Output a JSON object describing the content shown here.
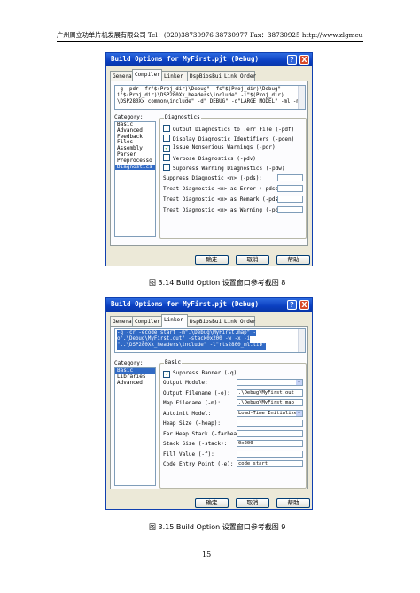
{
  "page_header": {
    "text": "广州周立功单片机发展有限公司    Tel：(020)38730976    38730977    Fax：38730925    http://www.zlgmcu.com"
  },
  "dialog1": {
    "title": "Build Options for MyFirst.pjt (Debug)",
    "help_btn": "?",
    "close_btn": "X",
    "tabs": [
      "General",
      "Compiler",
      "Linker",
      "DspBiosBuilder",
      "Link Order"
    ],
    "active_tab": 1,
    "options_lines": [
      "-g -pdr -fr\"$(Proj_dir)\\Debug\" -fs\"$(Proj_dir)\\Debug\" -",
      "i\"$(Proj_dir)\\DSP280Xx_headers\\include\" -i\"$(Proj_dir)",
      "\\DSP280Xx_common\\include\" -d\"_DEBUG\" -d\"LARGE_MODEL\" -ml -mt"
    ],
    "category_label": "Category:",
    "categories": [
      "Basic",
      "Advanced",
      "Feedback",
      "Files",
      "Assembly",
      "Parser",
      "Preprocesso",
      "Diagnostics"
    ],
    "selected_category": 7,
    "group_title": "Diagnostics",
    "checkboxes": [
      {
        "label": "Output Diagnostics to .err File (-pdf)",
        "checked": false
      },
      {
        "label": "Display Diagnostic Identifiers (-pden)",
        "checked": false
      },
      {
        "label": "Issue Nonserious Warnings (-pdr)",
        "checked": true
      },
      {
        "label": "Verbose Diagnostics (-pdv)",
        "checked": false
      },
      {
        "label": "Suppress Warning Diagnostics (-pdw)",
        "checked": false
      }
    ],
    "fields": [
      "Suppress Diagnostic <n> (-pds):",
      "Treat Diagnostic <n> as Error (-pdse):",
      "Treat Diagnostic <n> as Remark (-pdsr):",
      "Treat Diagnostic <n> as Warning (-pdsw):"
    ],
    "ok": "确定",
    "cancel": "取消",
    "help": "帮助"
  },
  "caption1": "图  3.14    Build Option 设置窗口参考截图 8",
  "dialog2": {
    "title": "Build Options for MyFirst.pjt (Debug)",
    "help_btn": "?",
    "close_btn": "X",
    "tabs": [
      "General",
      "Compiler",
      "Linker",
      "DspBiosBuilder",
      "Link Order"
    ],
    "active_tab": 2,
    "options_lines": [
      "-q -cr -ecode_start -m\".\\Debug\\MyFirst.map\" -",
      "o\".\\Debug\\MyFirst.out\" -stack0x200 -w -x -i",
      "\"..\\DSP280Xx_headers\\include\" -l\"rts2800_ml.lib\""
    ],
    "category_label": "Category:",
    "categories": [
      "Basic",
      "Libraries",
      "Advanced"
    ],
    "selected_category": 0,
    "group_title": "Basic",
    "suppress_banner": {
      "label": "Suppress Banner (-q)",
      "checked": true
    },
    "fields": [
      {
        "label": "Output Module:",
        "value": "",
        "combo": true
      },
      {
        "label": "Output Filename (-o):",
        "value": ".\\Debug\\MyFirst.out",
        "combo": false
      },
      {
        "label": "Map Filename (-m):",
        "value": ".\\Debug\\MyFirst.map",
        "combo": false
      },
      {
        "label": "Autoinit Model:",
        "value": "Load-Time Initialize",
        "combo": true
      },
      {
        "label": "Heap Size (-heap):",
        "value": "",
        "combo": false
      },
      {
        "label": "Far Heap Stack (-farheap):",
        "value": "",
        "combo": false
      },
      {
        "label": "Stack Size (-stack):",
        "value": "0x200",
        "combo": false
      },
      {
        "label": "Fill Value (-f):",
        "value": "",
        "combo": false
      },
      {
        "label": "Code Entry Point (-e):",
        "value": "code_start",
        "combo": false
      }
    ],
    "ok": "确定",
    "cancel": "取消",
    "help": "帮助"
  },
  "caption2": "图  3.15    Build Option 设置窗口参考截图 9",
  "page_number": "15"
}
